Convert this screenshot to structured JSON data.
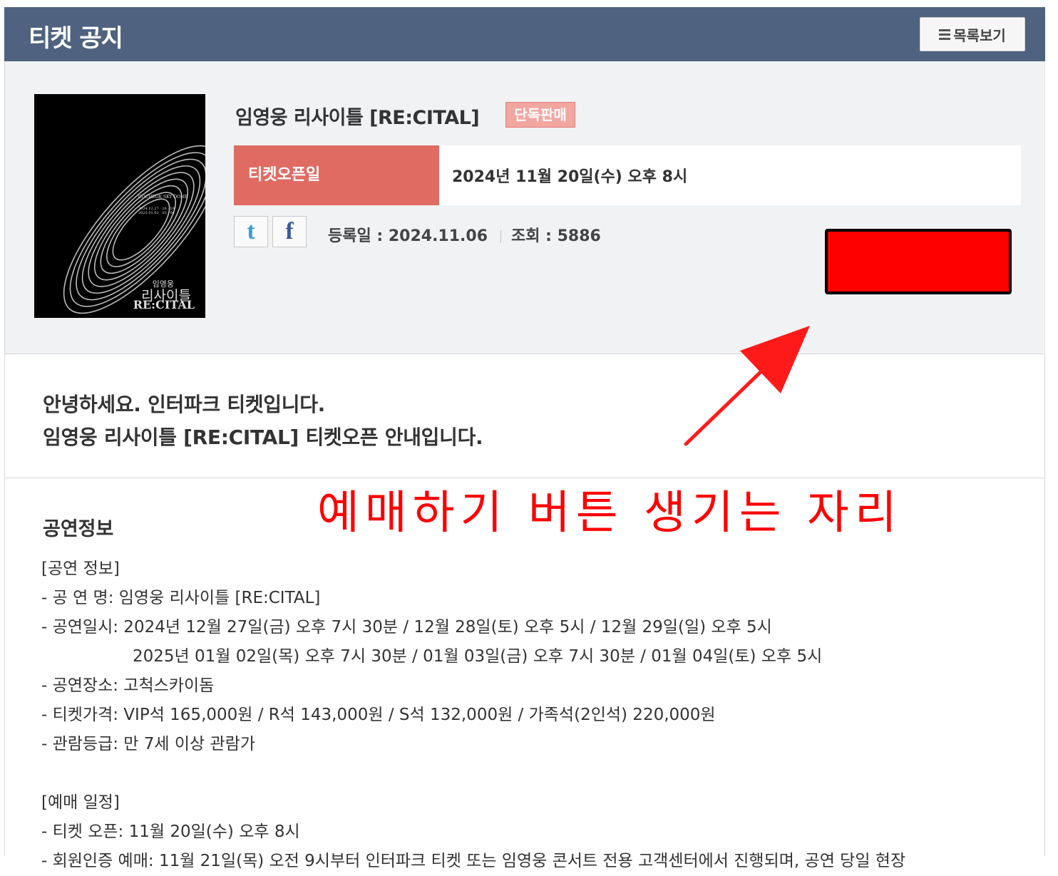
{
  "header": {
    "title": "티켓 공지",
    "list_button_label": "목록보기"
  },
  "show": {
    "title": "임영웅 리사이틀 [RE:CITAL]",
    "badge": "단독판매",
    "open_label": "티켓오픈일",
    "open_value": "2024년 11월 20일(수) 오후 8시",
    "registered": "등록일 : 2024.11.06",
    "views": "조회 : 5886"
  },
  "poster": {
    "venue": "COCHEOK SKY DOME",
    "dates": [
      "2024.12.27 · 28 · 29",
      "2025.01.02 · 03 · 04"
    ],
    "name_ko_small": "임영웅",
    "name_ko": "리사이틀",
    "name_en": "RE:CITAL"
  },
  "share": {
    "twitter_icon": "t",
    "facebook_icon": "f"
  },
  "greeting": [
    "안녕하세요. 인터파크 티켓입니다.",
    "임영웅 리사이틀 [RE:CITAL] 티켓오픈 안내입니다."
  ],
  "annotation": "예매하기 버튼 생기는 자리",
  "colors": {
    "header": "#4f6380",
    "accent": "#e06b63",
    "annotation": "#ff0000"
  },
  "section_title": "공연정보",
  "info_lines": {
    "h1": "[공연 정보]",
    "l1": "- 공 연 명: 임영웅 리사이틀 [RE:CITAL]",
    "l2": "- 공연일시: 2024년 12월 27일(금) 오후 7시 30분 / 12월 28일(토) 오후 5시 / 12월 29일(일) 오후 5시",
    "l3": "2025년 01월 02일(목) 오후 7시 30분 / 01월 03일(금) 오후 7시 30분 / 01월 04일(토) 오후 5시",
    "l4": "- 공연장소: 고척스카이돔",
    "l5": "- 티켓가격: VIP석 165,000원 / R석 143,000원 / S석 132,000원 / 가족석(2인석) 220,000원",
    "l6": "- 관람등급: 만 7세 이상 관람가",
    "h2": "[예매 일정]",
    "l7": "- 티켓 오픈: 11월 20일(수) 오후 8시",
    "l8": "- 회원인증 예매: 11월 21일(목) 오전 9시부터 인터파크 티켓 또는 임영웅 콘서트 전용 고객센터에서 진행되며, 공연 당일 현장"
  }
}
